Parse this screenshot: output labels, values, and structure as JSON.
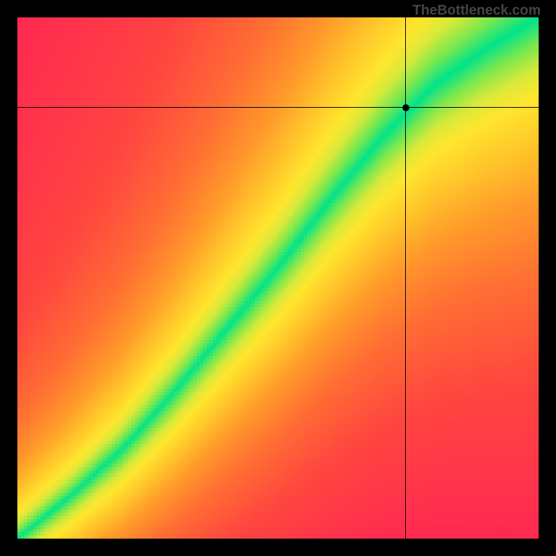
{
  "watermark": "TheBottleneck.com",
  "chart_data": {
    "type": "heatmap",
    "title": "",
    "xlabel": "",
    "ylabel": "",
    "xlim": [
      0,
      1
    ],
    "ylim": [
      0,
      1
    ],
    "marker": {
      "x": 0.745,
      "y": 0.827
    },
    "crosshair": {
      "x": 0.745,
      "y": 0.827
    },
    "optimal_band": {
      "description": "Green band center follows a slight S-curve from (0,0) to (1,1); width ~0.07 of axis.",
      "samples": [
        {
          "x": 0.0,
          "y": 0.0
        },
        {
          "x": 0.1,
          "y": 0.08
        },
        {
          "x": 0.2,
          "y": 0.17
        },
        {
          "x": 0.3,
          "y": 0.28
        },
        {
          "x": 0.4,
          "y": 0.4
        },
        {
          "x": 0.5,
          "y": 0.52
        },
        {
          "x": 0.6,
          "y": 0.65
        },
        {
          "x": 0.7,
          "y": 0.77
        },
        {
          "x": 0.8,
          "y": 0.87
        },
        {
          "x": 0.9,
          "y": 0.94
        },
        {
          "x": 1.0,
          "y": 1.0
        }
      ],
      "half_width": 0.05
    },
    "color_scale": {
      "stops": [
        {
          "d": 0.0,
          "color": "#00e38a"
        },
        {
          "d": 0.05,
          "color": "#7be84e"
        },
        {
          "d": 0.1,
          "color": "#d9e93a"
        },
        {
          "d": 0.15,
          "color": "#ffe62e"
        },
        {
          "d": 0.25,
          "color": "#ffc22a"
        },
        {
          "d": 0.35,
          "color": "#ff9a2a"
        },
        {
          "d": 0.5,
          "color": "#ff6e33"
        },
        {
          "d": 0.7,
          "color": "#ff463f"
        },
        {
          "d": 1.0,
          "color": "#ff2a50"
        }
      ]
    },
    "grid_resolution": 160
  }
}
